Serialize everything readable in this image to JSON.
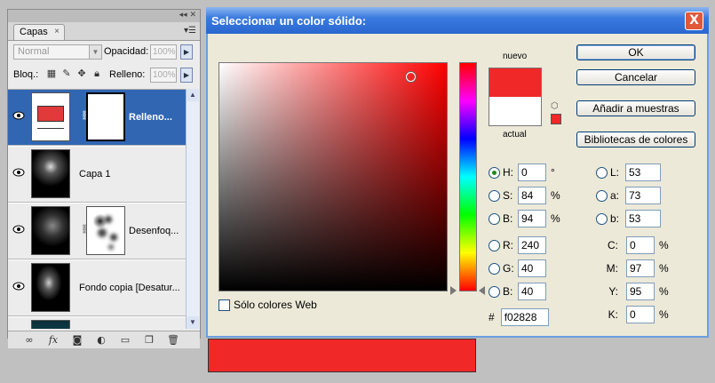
{
  "layers_panel": {
    "tab_label": "Capas",
    "tab_close": "×",
    "blend_mode": "Normal",
    "opacity_label": "Opacidad:",
    "opacity_value": "100%",
    "lock_label": "Bloq.:",
    "fill_label": "Relleno:",
    "fill_value": "100%",
    "layers": [
      {
        "name": "Relleno...",
        "selected": true
      },
      {
        "name": "Capa 1",
        "selected": false
      },
      {
        "name": "Desenfoq...",
        "selected": false
      },
      {
        "name": "Fondo copia [Desatur...",
        "selected": false
      }
    ],
    "footer_icons": [
      "link-icon",
      "fx-icon",
      "mask-icon",
      "adjustment-icon",
      "folder-icon",
      "new-layer-icon",
      "trash-icon"
    ]
  },
  "dialog": {
    "title": "Seleccionar un color sólido:",
    "close_label": "X",
    "new_label": "nuevo",
    "current_label": "actual",
    "new_color": "#f02828",
    "current_color": "#ffffff",
    "buttons": {
      "ok": "OK",
      "cancel": "Cancelar",
      "add_swatch": "Añadir a muestras",
      "libraries": "Bibliotecas de colores"
    },
    "web_only_label": "Sólo colores Web",
    "hsb": [
      {
        "key": "H:",
        "value": "0",
        "unit": "°",
        "selected": true
      },
      {
        "key": "S:",
        "value": "84",
        "unit": "%",
        "selected": false
      },
      {
        "key": "B:",
        "value": "94",
        "unit": "%",
        "selected": false
      }
    ],
    "rgb": [
      {
        "key": "R:",
        "value": "240"
      },
      {
        "key": "G:",
        "value": "40"
      },
      {
        "key": "B:",
        "value": "40"
      }
    ],
    "lab": [
      {
        "key": "L:",
        "value": "53"
      },
      {
        "key": "a:",
        "value": "73"
      },
      {
        "key": "b:",
        "value": "53"
      }
    ],
    "cmyk": [
      {
        "key": "C:",
        "value": "0",
        "unit": "%"
      },
      {
        "key": "M:",
        "value": "97",
        "unit": "%"
      },
      {
        "key": "Y:",
        "value": "95",
        "unit": "%"
      },
      {
        "key": "K:",
        "value": "0",
        "unit": "%"
      }
    ],
    "hex_label": "#",
    "hex_value": "f02828"
  }
}
